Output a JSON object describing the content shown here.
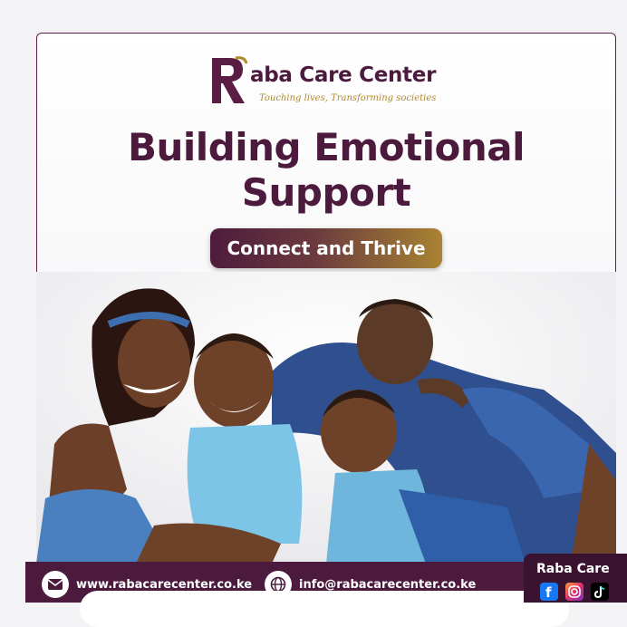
{
  "brand": {
    "name": "aba Care Center",
    "tagline": "Touching lives, Transforming societies",
    "logo_letter": "R"
  },
  "headline": {
    "line1": "Building Emotional",
    "line2": "Support"
  },
  "cta": {
    "label": "Connect and Thrive"
  },
  "photo": {
    "icon": "family-photo"
  },
  "footer": {
    "website": "www.rabacarecenter.co.ke",
    "email": "info@rabacarecenter.co.ke",
    "social_label": "Raba Care",
    "social_icons": [
      "facebook-icon",
      "instagram-icon",
      "tiktok-icon"
    ]
  },
  "colors": {
    "brand_purple": "#4b1a3c",
    "gold": "#a88432",
    "footer_bg": "#4b1a3c"
  }
}
